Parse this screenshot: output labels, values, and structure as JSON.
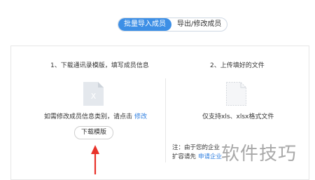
{
  "tabs": [
    {
      "label": "批量导入成员",
      "active": true
    },
    {
      "label": "导出/修改成员",
      "active": false
    }
  ],
  "left": {
    "step_label": "1、下载通讯录模版，填写成员信息",
    "icon_text": "X",
    "hint_text": "如需修改成员信息类别，请点击",
    "hint_link": "修改",
    "download_button": "下载模版"
  },
  "right": {
    "step_label": "2、上传填好的文件",
    "hint_text": "仅支持xls、xlsx格式文件",
    "note_line1": "注：由于您的企业",
    "note_line2_prefix": "扩容请先",
    "note_line2_link": "申请企业"
  },
  "watermark": "软件技巧",
  "colors": {
    "accent": "#3d8fe6",
    "link": "#2f7fe0",
    "arrow": "#e8322a"
  }
}
